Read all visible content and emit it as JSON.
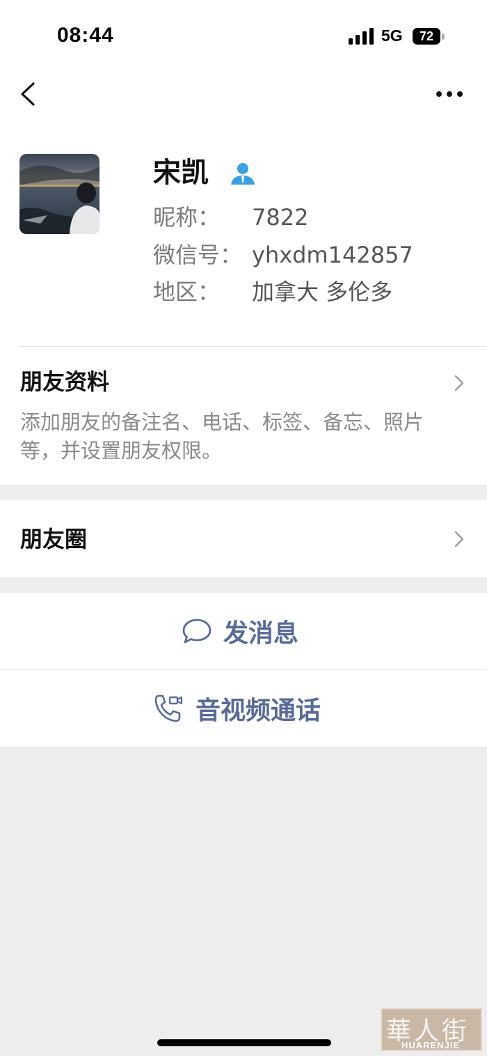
{
  "status_bar": {
    "time": "08:44",
    "network": "5G",
    "battery": "72",
    "signal_icon": "cellular-signal-icon"
  },
  "nav": {
    "back_icon": "chevron-left-icon",
    "more_icon": "more-dots-icon"
  },
  "profile": {
    "name": "宋凯",
    "contact_icon": "contact-person-icon",
    "nickname_label": "昵称：",
    "nickname_value": "7822",
    "wechat_id_label": "微信号：",
    "wechat_id_value": "yhxdm142857",
    "region_label": "地区：",
    "region_value": "加拿大 多伦多"
  },
  "friend_info": {
    "title": "朋友资料",
    "description": "添加朋友的备注名、电话、标签、备忘、照片等，并设置朋友权限。"
  },
  "moments": {
    "title": "朋友圈"
  },
  "actions": {
    "send_message": "发消息",
    "av_call": "音视频通话",
    "message_icon": "chat-bubble-icon",
    "call_icon": "phone-video-icon"
  },
  "watermark": {
    "glyphs": "華人街",
    "text": "HUARENJIE"
  },
  "colors": {
    "accent": "#576b95",
    "background": "#ededed",
    "contact_icon": "#3aa0e6"
  }
}
